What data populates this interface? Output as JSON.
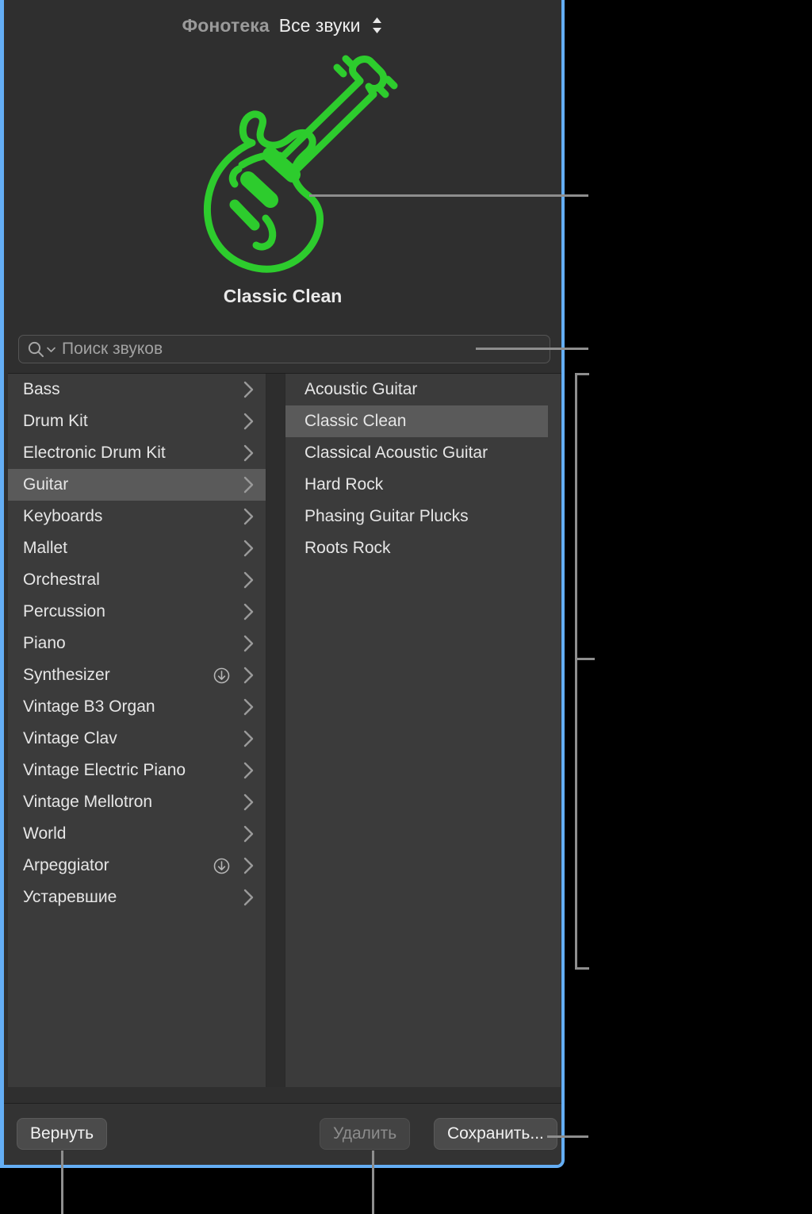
{
  "window": {
    "accent_border_color": "#64aef5",
    "panel_background": "#2f2f2f",
    "list_background": "#3b3b3b",
    "selection_color": "#5a5a5a"
  },
  "header": {
    "library_label": "Фонотека",
    "library_value": "Все звуки",
    "updown_icon": "updown-chevron-icon"
  },
  "artwork": {
    "icon_name": "electric-guitar-icon",
    "icon_color": "#2dcc2d",
    "patch_name": "Classic Clean"
  },
  "search": {
    "placeholder": "Поиск звуков",
    "value": "",
    "icon": "search-icon",
    "caret_icon": "chevron-down-icon"
  },
  "categories": [
    {
      "label": "Bass",
      "selected": false,
      "download": false
    },
    {
      "label": "Drum Kit",
      "selected": false,
      "download": false
    },
    {
      "label": "Electronic Drum Kit",
      "selected": false,
      "download": false
    },
    {
      "label": "Guitar",
      "selected": true,
      "download": false
    },
    {
      "label": "Keyboards",
      "selected": false,
      "download": false
    },
    {
      "label": "Mallet",
      "selected": false,
      "download": false
    },
    {
      "label": "Orchestral",
      "selected": false,
      "download": false
    },
    {
      "label": "Percussion",
      "selected": false,
      "download": false
    },
    {
      "label": "Piano",
      "selected": false,
      "download": false
    },
    {
      "label": "Synthesizer",
      "selected": false,
      "download": true
    },
    {
      "label": "Vintage B3 Organ",
      "selected": false,
      "download": false
    },
    {
      "label": "Vintage Clav",
      "selected": false,
      "download": false
    },
    {
      "label": "Vintage Electric Piano",
      "selected": false,
      "download": false
    },
    {
      "label": "Vintage Mellotron",
      "selected": false,
      "download": false
    },
    {
      "label": "World",
      "selected": false,
      "download": false
    },
    {
      "label": "Arpeggiator",
      "selected": false,
      "download": true
    },
    {
      "label": "Устаревшие",
      "selected": false,
      "download": false
    }
  ],
  "patches": [
    {
      "label": "Acoustic Guitar",
      "selected": false
    },
    {
      "label": "Classic Clean",
      "selected": true
    },
    {
      "label": "Classical Acoustic Guitar",
      "selected": false
    },
    {
      "label": "Hard Rock",
      "selected": false
    },
    {
      "label": "Phasing Guitar Plucks",
      "selected": false
    },
    {
      "label": "Roots Rock",
      "selected": false
    }
  ],
  "footer": {
    "revert_label": "Вернуть",
    "delete_label": "Удалить",
    "delete_disabled": true,
    "save_label": "Сохранить..."
  }
}
